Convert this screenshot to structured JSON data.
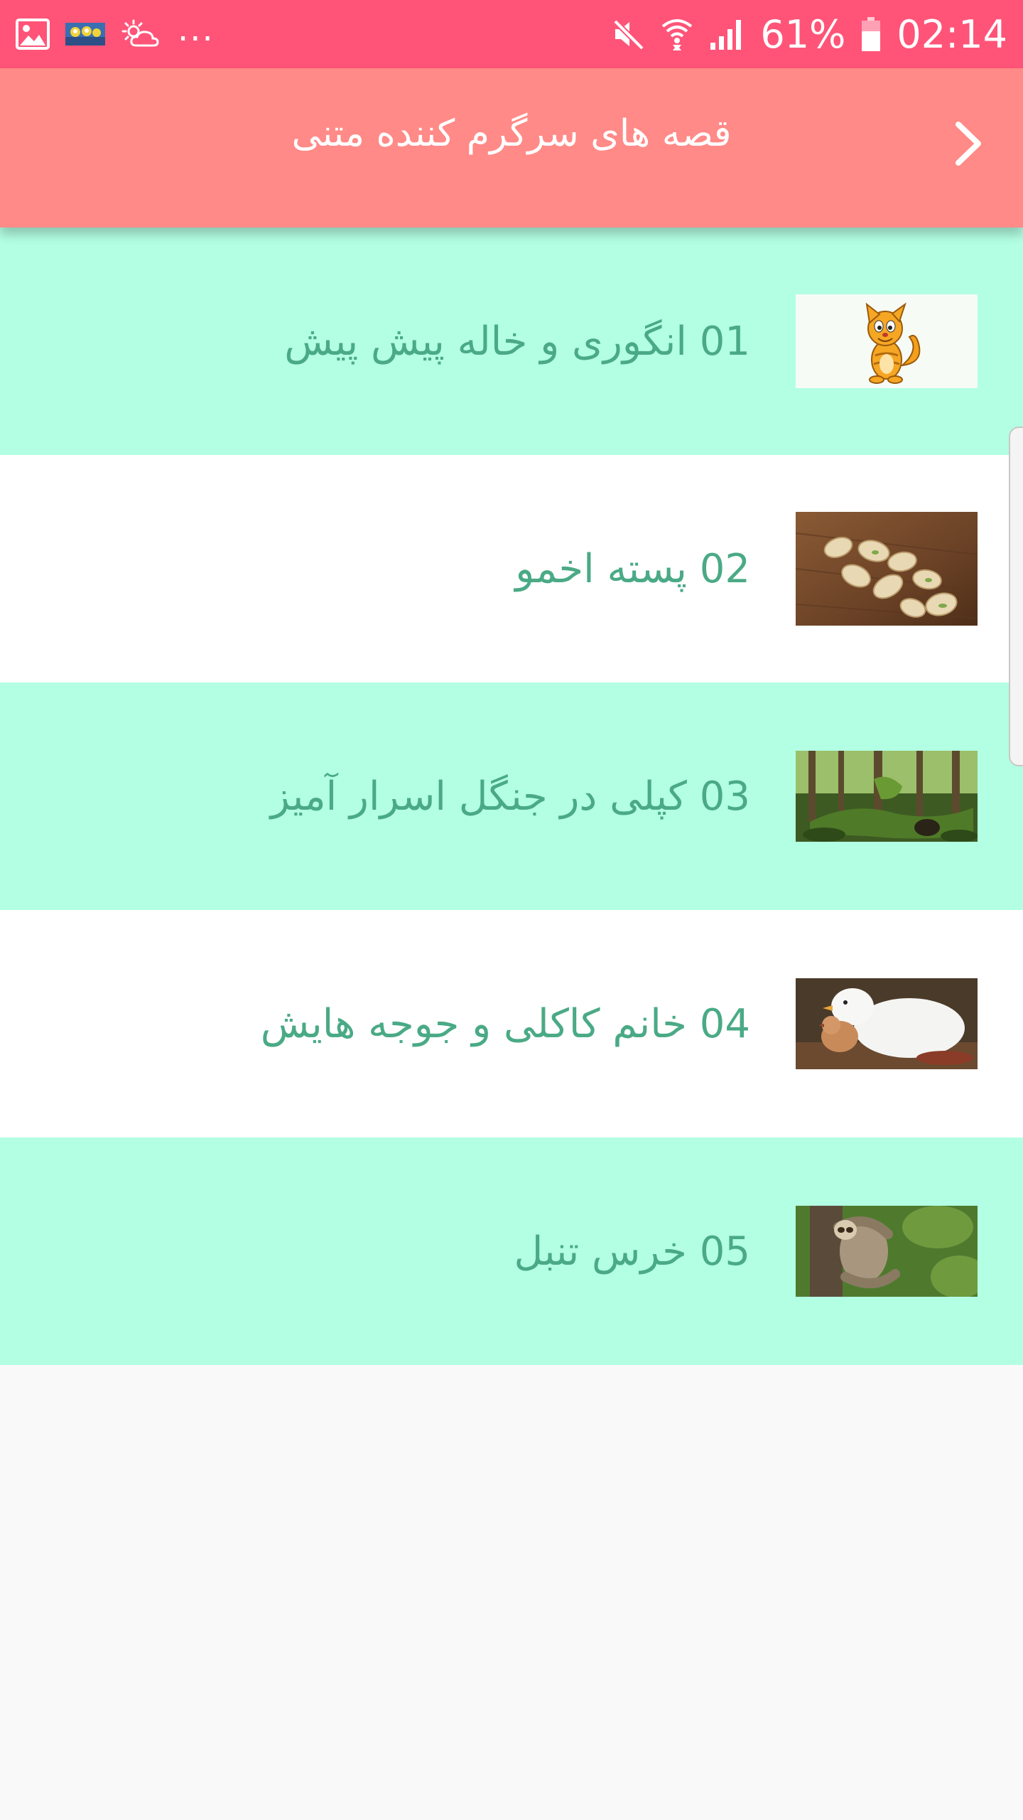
{
  "status_bar": {
    "icons_left": [
      "gallery-icon",
      "minions-thumbnail-icon",
      "weather-icon"
    ],
    "more": "...",
    "icons_right": [
      "mute-icon",
      "wifi-icon",
      "signal-icon"
    ],
    "battery": "61%",
    "time": "02:14"
  },
  "app_bar": {
    "title": "قصه های سرگرم کننده متنی",
    "back_icon": "chevron-right-icon"
  },
  "stories": [
    {
      "label": "01 انگوری و خاله پیش پیش",
      "image": "cat-cartoon"
    },
    {
      "label": "02 پسته اخمو",
      "image": "pistachios"
    },
    {
      "label": "03 کپلی در جنگل اسرار آمیز",
      "image": "forest"
    },
    {
      "label": "04 خانم کاکلی و جوجه هایش",
      "image": "hen-with-chick"
    },
    {
      "label": "05 خرس تنبل",
      "image": "sloth"
    }
  ],
  "colors": {
    "status_bar": "#ff5478",
    "app_bar": "#ff8a87",
    "row_tint": "#b3ffe3",
    "row_plain": "#ffffff",
    "text": "#4aaa86"
  }
}
